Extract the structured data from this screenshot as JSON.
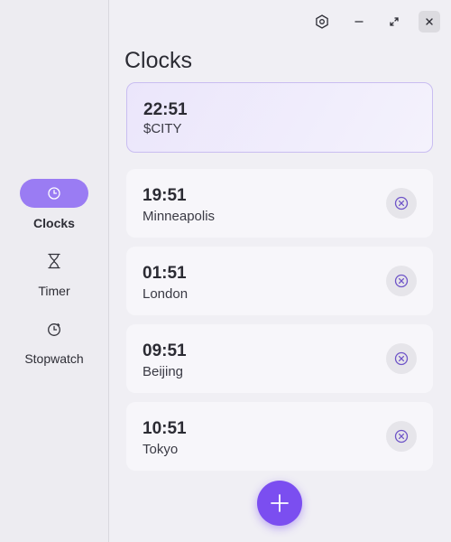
{
  "window": {
    "controls": [
      "settings-icon",
      "minimize-icon",
      "maximize-icon",
      "close-icon"
    ]
  },
  "sidebar": {
    "items": [
      {
        "label": "Clocks",
        "icon": "clock-icon",
        "active": true
      },
      {
        "label": "Timer",
        "icon": "hourglass-icon",
        "active": false
      },
      {
        "label": "Stopwatch",
        "icon": "stopwatch-icon",
        "active": false
      }
    ]
  },
  "main": {
    "title": "Clocks",
    "local_clock": {
      "time": "22:51",
      "city": "$CITY"
    },
    "clocks": [
      {
        "time": "19:51",
        "city": "Minneapolis"
      },
      {
        "time": "01:51",
        "city": "London"
      },
      {
        "time": "09:51",
        "city": "Beijing"
      },
      {
        "time": "10:51",
        "city": "Tokyo"
      }
    ],
    "add_button_icon": "plus-icon"
  },
  "colors": {
    "accent": "#7b4ef0",
    "nav_active": "#9a7cf3",
    "local_card_border": "#c9bdf1",
    "remove_icon": "#6f55c8"
  }
}
